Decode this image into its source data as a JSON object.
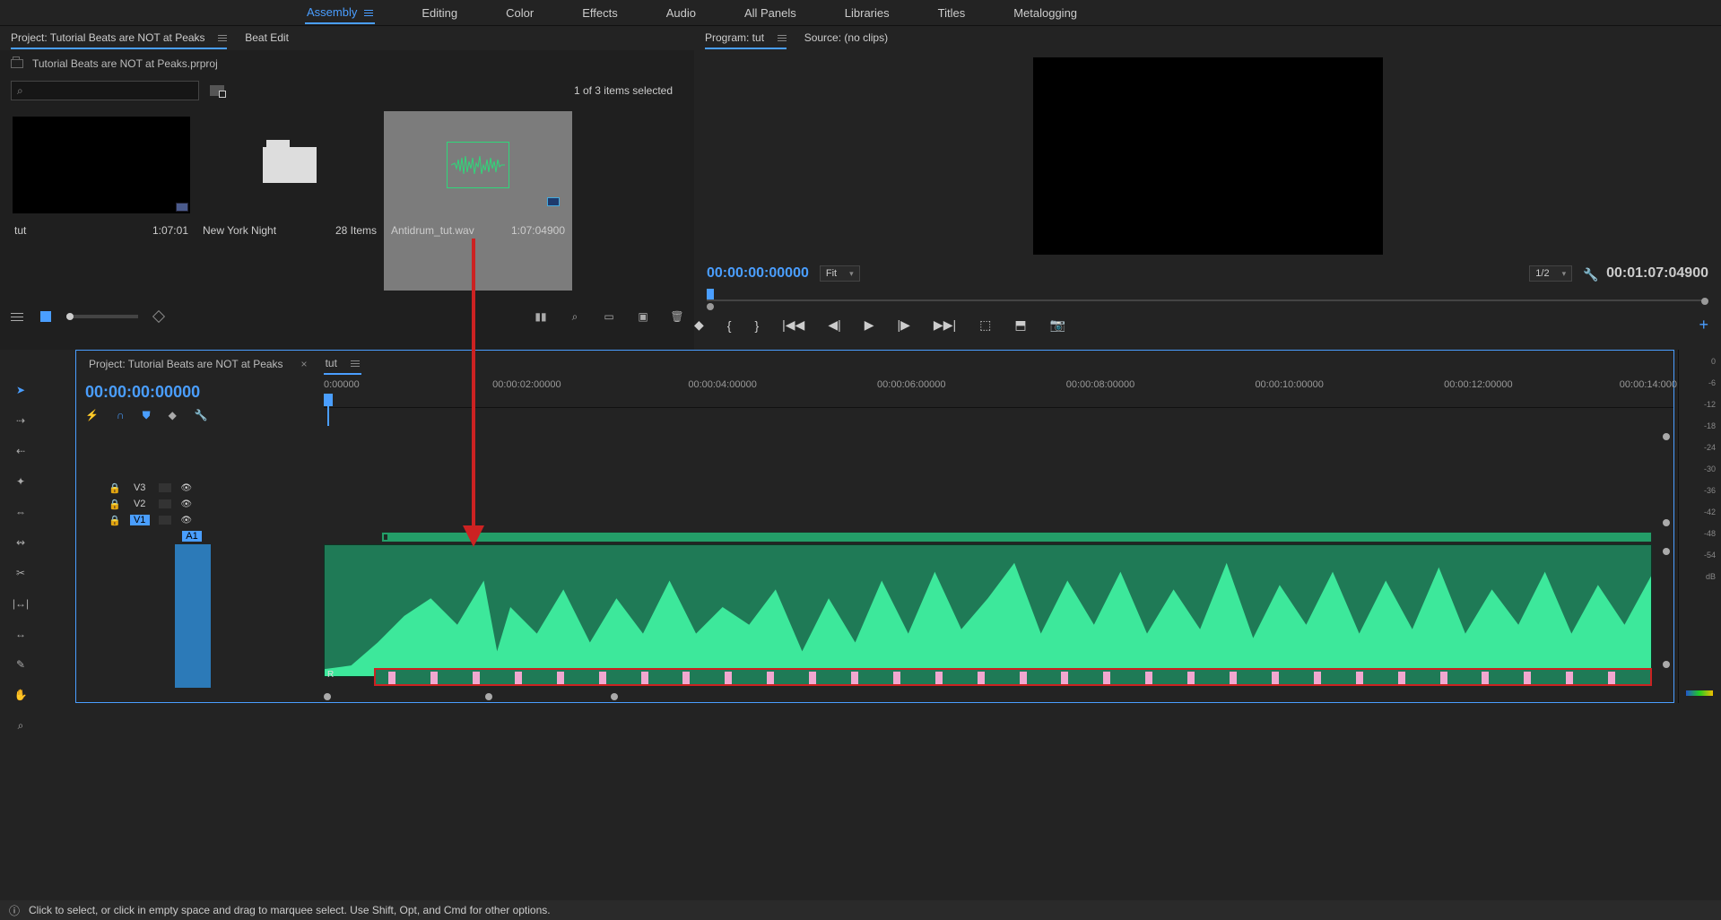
{
  "top_menu": {
    "items": [
      "Assembly",
      "Editing",
      "Color",
      "Effects",
      "Audio",
      "All Panels",
      "Libraries",
      "Titles",
      "Metalogging"
    ],
    "active": "Assembly"
  },
  "project_panel": {
    "tab_project": "Project: Tutorial Beats are NOT at Peaks",
    "tab_beat": "Beat Edit",
    "breadcrumb": "Tutorial Beats are NOT at Peaks.prproj",
    "search_placeholder": "",
    "selection_count": "1 of 3 items selected",
    "items": [
      {
        "name": "tut",
        "meta": "1:07:01",
        "type": "sequence"
      },
      {
        "name": "New York Night",
        "meta": "28 Items",
        "type": "bin"
      },
      {
        "name": "Antidrum_tut.wav",
        "meta": "1:07:04900",
        "type": "audio"
      }
    ]
  },
  "program_panel": {
    "tab_program": "Program: tut",
    "tab_source": "Source: (no clips)",
    "timecode": "00:00:00:00000",
    "fit": "Fit",
    "zoom": "1/2",
    "duration": "00:01:07:04900"
  },
  "timeline": {
    "tab_project": "Project: Tutorial Beats are NOT at Peaks",
    "tab_seq": "tut",
    "timecode": "00:00:00:00000",
    "ruler": [
      "0:00000",
      "00:00:02:00000",
      "00:00:04:00000",
      "00:00:06:00000",
      "00:00:08:00000",
      "00:00:10:00000",
      "00:00:12:00000",
      "00:00:14:000"
    ],
    "tracks": {
      "v3": "V3",
      "v2": "V2",
      "v1": "V1",
      "a1": "A1"
    }
  },
  "meter_scale": [
    "0",
    "-6",
    "-12",
    "-18",
    "-24",
    "-30",
    "-36",
    "-42",
    "-48",
    "-54",
    "dB"
  ],
  "status_bar": "Click to select, or click in empty space and drag to marquee select. Use Shift, Opt, and Cmd for other options."
}
